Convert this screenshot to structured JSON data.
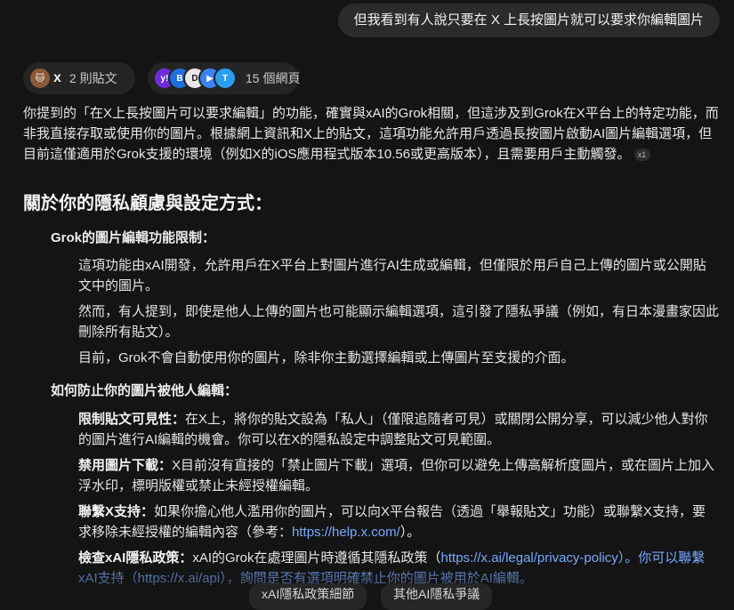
{
  "user_message": "但我看到有人說只要在 X 上長按圖片就可以要求你編輯圖片",
  "sources": {
    "posts_label": "2 則貼文",
    "web_label": "15 個網頁",
    "x_logo": "x",
    "web_avatar_letters": [
      "y!",
      "B",
      "D",
      "▶",
      "T"
    ],
    "web_avatar_colors": [
      "#6e2bd9",
      "#1f6fe0",
      "#e8e8e8",
      "#3b82f6",
      "#2a9df4"
    ]
  },
  "intro": {
    "text": "你提到的「在X上長按圖片可以要求編輯」的功能，確實與xAI的Grok相關，但這涉及到Grok在X平台上的特定功能，而非我直接存取或使用你的圖片。根據網上資訊和X上的貼文，這項功能允許用戶透過長按圖片啟動AI圖片編輯選項，但目前這僅適用於Grok支援的環境（例如X的iOS應用程式版本10.56或更高版本），且需要用戶主動觸發。",
    "citation": "x1"
  },
  "heading": "關於你的隱私顧慮與設定方式：",
  "section1": {
    "title": "Grok的圖片編輯功能限制：",
    "items": [
      "這項功能由xAI開發，允許用戶在X平台上對圖片進行AI生成或編輯，但僅限於用戶自己上傳的圖片或公開貼文中的圖片。",
      "然而，有人提到，即使是他人上傳的圖片也可能顯示編輯選項，這引發了隱私爭議（例如，有日本漫畫家因此刪除所有貼文）。",
      "目前，Grok不會自動使用你的圖片，除非你主動選擇編輯或上傳圖片至支援的介面。"
    ]
  },
  "section2": {
    "title": "如何防止你的圖片被他人編輯：",
    "items": [
      {
        "label": "限制貼文可見性：",
        "text": "在X上，將你的貼文設為「私人」（僅限追隨者可見）或關閉公開分享，可以減少他人對你的圖片進行AI編輯的機會。你可以在X的隱私設定中調整貼文可見範圍。"
      },
      {
        "label": "禁用圖片下載：",
        "text": "X目前沒有直接的「禁止圖片下載」選項，但你可以避免上傳高解析度圖片，或在圖片上加入浮水印，標明版權或禁止未經授權編輯。"
      },
      {
        "label": "聯繫X支持：",
        "text": "如果你擔心他人濫用你的圖片，可以向X平台報告（透過「舉報貼文」功能）或聯繫X支持，要求移除未經授權的編輯內容（參考：",
        "link": "https://help.x.com/",
        "tail": "）。"
      },
      {
        "label": "檢查xAI隱私政策：",
        "text": "xAI的Grok在處理圖片時遵循其隱私政策（",
        "link": "https://x.ai/legal/privacy-policy",
        "tail": "）。你可以聯繫xAI支持（https://x.ai/api），詢問是否有選項明確禁止你的圖片被用於AI編輯。"
      }
    ]
  },
  "suggestions": [
    "xAI隱私政策細節",
    "其他AI隱私爭議"
  ]
}
